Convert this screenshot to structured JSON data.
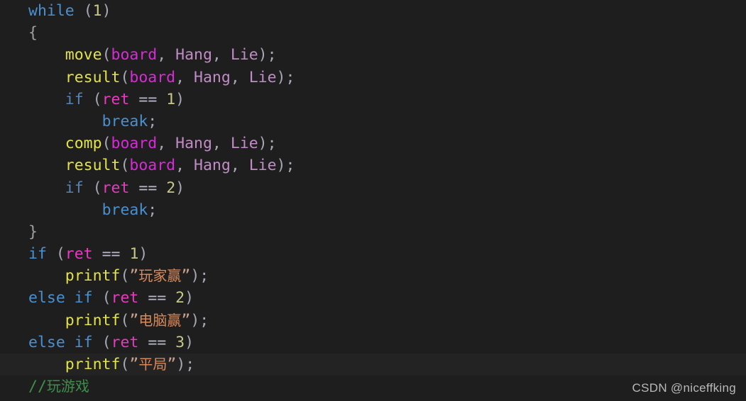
{
  "editor": {
    "background_color": "#1e1e1e",
    "highlight_color": "#232323",
    "language": "C",
    "font_size_px": 21.5,
    "line_height_px": 31.2,
    "highlighted_line_index": 16,
    "lines": [
      {
        "index": 0,
        "indent": "",
        "tokens": [
          {
            "text": "while",
            "kind": "keyword"
          },
          {
            "text": " ",
            "kind": "plain"
          },
          {
            "text": "(",
            "kind": "punct"
          },
          {
            "text": "1",
            "kind": "number"
          },
          {
            "text": ")",
            "kind": "punct"
          }
        ]
      },
      {
        "index": 1,
        "indent": "",
        "tokens": [
          {
            "text": "{",
            "kind": "brace"
          }
        ]
      },
      {
        "index": 2,
        "indent": "    ",
        "tokens": [
          {
            "text": "move",
            "kind": "function"
          },
          {
            "text": "(",
            "kind": "punct"
          },
          {
            "text": "board",
            "kind": "variable"
          },
          {
            "text": ", ",
            "kind": "punct"
          },
          {
            "text": "Hang",
            "kind": "param"
          },
          {
            "text": ", ",
            "kind": "punct"
          },
          {
            "text": "Lie",
            "kind": "param"
          },
          {
            "text": ")",
            "kind": "punct"
          },
          {
            "text": ";",
            "kind": "punct"
          }
        ]
      },
      {
        "index": 3,
        "indent": "    ",
        "tokens": [
          {
            "text": "result",
            "kind": "function"
          },
          {
            "text": "(",
            "kind": "punct"
          },
          {
            "text": "board",
            "kind": "variable"
          },
          {
            "text": ", ",
            "kind": "punct"
          },
          {
            "text": "Hang",
            "kind": "param"
          },
          {
            "text": ", ",
            "kind": "punct"
          },
          {
            "text": "Lie",
            "kind": "param"
          },
          {
            "text": ")",
            "kind": "punct"
          },
          {
            "text": ";",
            "kind": "punct"
          }
        ]
      },
      {
        "index": 4,
        "indent": "    ",
        "tokens": [
          {
            "text": "if",
            "kind": "keyword-dim"
          },
          {
            "text": " ",
            "kind": "plain"
          },
          {
            "text": "(",
            "kind": "punct"
          },
          {
            "text": "ret",
            "kind": "identifier"
          },
          {
            "text": " ",
            "kind": "plain"
          },
          {
            "text": "==",
            "kind": "operator"
          },
          {
            "text": " ",
            "kind": "plain"
          },
          {
            "text": "1",
            "kind": "number"
          },
          {
            "text": ")",
            "kind": "punct"
          }
        ]
      },
      {
        "index": 5,
        "indent": "        ",
        "tokens": [
          {
            "text": "break",
            "kind": "keyword"
          },
          {
            "text": ";",
            "kind": "punct"
          }
        ]
      },
      {
        "index": 6,
        "indent": "    ",
        "tokens": [
          {
            "text": "comp",
            "kind": "function"
          },
          {
            "text": "(",
            "kind": "punct"
          },
          {
            "text": "board",
            "kind": "variable"
          },
          {
            "text": ", ",
            "kind": "punct"
          },
          {
            "text": "Hang",
            "kind": "param"
          },
          {
            "text": ", ",
            "kind": "punct"
          },
          {
            "text": "Lie",
            "kind": "param"
          },
          {
            "text": ")",
            "kind": "punct"
          },
          {
            "text": ";",
            "kind": "punct"
          }
        ]
      },
      {
        "index": 7,
        "indent": "    ",
        "tokens": [
          {
            "text": "result",
            "kind": "function"
          },
          {
            "text": "(",
            "kind": "punct"
          },
          {
            "text": "board",
            "kind": "variable"
          },
          {
            "text": ", ",
            "kind": "punct"
          },
          {
            "text": "Hang",
            "kind": "param"
          },
          {
            "text": ", ",
            "kind": "punct"
          },
          {
            "text": "Lie",
            "kind": "param"
          },
          {
            "text": ")",
            "kind": "punct"
          },
          {
            "text": ";",
            "kind": "punct"
          }
        ]
      },
      {
        "index": 8,
        "indent": "    ",
        "tokens": [
          {
            "text": "if",
            "kind": "keyword-dim"
          },
          {
            "text": " ",
            "kind": "plain"
          },
          {
            "text": "(",
            "kind": "punct"
          },
          {
            "text": "ret",
            "kind": "identifier"
          },
          {
            "text": " ",
            "kind": "plain"
          },
          {
            "text": "==",
            "kind": "operator"
          },
          {
            "text": " ",
            "kind": "plain"
          },
          {
            "text": "2",
            "kind": "number"
          },
          {
            "text": ")",
            "kind": "punct"
          }
        ]
      },
      {
        "index": 9,
        "indent": "        ",
        "tokens": [
          {
            "text": "break",
            "kind": "keyword"
          },
          {
            "text": ";",
            "kind": "punct"
          }
        ]
      },
      {
        "index": 10,
        "indent": "",
        "tokens": [
          {
            "text": "}",
            "kind": "brace"
          }
        ]
      },
      {
        "index": 11,
        "indent": "",
        "tokens": [
          {
            "text": "if",
            "kind": "keyword"
          },
          {
            "text": " ",
            "kind": "plain"
          },
          {
            "text": "(",
            "kind": "punct"
          },
          {
            "text": "ret",
            "kind": "identifier"
          },
          {
            "text": " ",
            "kind": "plain"
          },
          {
            "text": "==",
            "kind": "operator"
          },
          {
            "text": " ",
            "kind": "plain"
          },
          {
            "text": "1",
            "kind": "number"
          },
          {
            "text": ")",
            "kind": "punct"
          }
        ]
      },
      {
        "index": 12,
        "indent": "    ",
        "tokens": [
          {
            "text": "printf",
            "kind": "function"
          },
          {
            "text": "(",
            "kind": "punct"
          },
          {
            "text": "”",
            "kind": "quote"
          },
          {
            "text": "玩家赢",
            "kind": "string-cjk"
          },
          {
            "text": "”",
            "kind": "quote"
          },
          {
            "text": ")",
            "kind": "punct"
          },
          {
            "text": ";",
            "kind": "punct"
          }
        ]
      },
      {
        "index": 13,
        "indent": "",
        "tokens": [
          {
            "text": "else",
            "kind": "keyword"
          },
          {
            "text": " ",
            "kind": "plain"
          },
          {
            "text": "if",
            "kind": "keyword"
          },
          {
            "text": " ",
            "kind": "plain"
          },
          {
            "text": "(",
            "kind": "punct"
          },
          {
            "text": "ret",
            "kind": "identifier"
          },
          {
            "text": " ",
            "kind": "plain"
          },
          {
            "text": "==",
            "kind": "operator"
          },
          {
            "text": " ",
            "kind": "plain"
          },
          {
            "text": "2",
            "kind": "number"
          },
          {
            "text": ")",
            "kind": "punct"
          }
        ]
      },
      {
        "index": 14,
        "indent": "    ",
        "tokens": [
          {
            "text": "printf",
            "kind": "function"
          },
          {
            "text": "(",
            "kind": "punct"
          },
          {
            "text": "”",
            "kind": "quote"
          },
          {
            "text": "电脑赢",
            "kind": "string-cjk"
          },
          {
            "text": "”",
            "kind": "quote"
          },
          {
            "text": ")",
            "kind": "punct"
          },
          {
            "text": ";",
            "kind": "punct"
          }
        ]
      },
      {
        "index": 15,
        "indent": "",
        "tokens": [
          {
            "text": "else",
            "kind": "keyword"
          },
          {
            "text": " ",
            "kind": "plain"
          },
          {
            "text": "if",
            "kind": "keyword"
          },
          {
            "text": " ",
            "kind": "plain"
          },
          {
            "text": "(",
            "kind": "punct"
          },
          {
            "text": "ret",
            "kind": "identifier"
          },
          {
            "text": " ",
            "kind": "plain"
          },
          {
            "text": "==",
            "kind": "operator"
          },
          {
            "text": " ",
            "kind": "plain"
          },
          {
            "text": "3",
            "kind": "number"
          },
          {
            "text": ")",
            "kind": "punct"
          }
        ]
      },
      {
        "index": 16,
        "indent": "    ",
        "tokens": [
          {
            "text": "printf",
            "kind": "function"
          },
          {
            "text": "(",
            "kind": "punct"
          },
          {
            "text": "”",
            "kind": "quote"
          },
          {
            "text": "平局",
            "kind": "string-cjk"
          },
          {
            "text": "”",
            "kind": "quote"
          },
          {
            "text": ")",
            "kind": "punct"
          },
          {
            "text": ";",
            "kind": "punct"
          }
        ]
      },
      {
        "index": 17,
        "indent": "",
        "tokens": [
          {
            "text": "//",
            "kind": "comment"
          },
          {
            "text": "玩游戏",
            "kind": "comment-cjk"
          }
        ]
      }
    ]
  },
  "watermark": {
    "text": "CSDN @niceffking",
    "color": "#b9b9b9"
  }
}
